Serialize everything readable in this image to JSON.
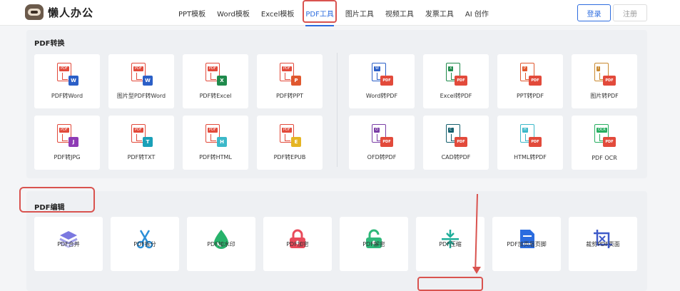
{
  "header": {
    "logo_text": "懒人办公",
    "nav": [
      "PPT模板",
      "Word模板",
      "Excel模板",
      "PDF工具",
      "图片工具",
      "视频工具",
      "发票工具",
      "AI 创作"
    ],
    "active_nav_index": 3,
    "login_label": "登录",
    "register_label": "注册"
  },
  "pdf_convert": {
    "title": "PDF转换",
    "left_row1": [
      {
        "label": "PDF转Word",
        "tag": "W",
        "color": "#2b5fc7"
      },
      {
        "label": "图片型PDF转Word",
        "tag": "W",
        "color": "#2b5fc7"
      },
      {
        "label": "PDF转Excel",
        "tag": "X",
        "color": "#1f8a4c"
      },
      {
        "label": "PDF转PPT",
        "tag": "P",
        "color": "#e0582f"
      }
    ],
    "left_row2": [
      {
        "label": "PDF转JPG",
        "tag": "J",
        "color": "#8e3bb5"
      },
      {
        "label": "PDF转TXT",
        "tag": "T",
        "color": "#1aa0b8"
      },
      {
        "label": "PDF转HTML",
        "tag": "H",
        "color": "#3cb8c9"
      },
      {
        "label": "PDF转EPUB",
        "tag": "E",
        "color": "#e5b523"
      }
    ],
    "right_row1": [
      {
        "label": "Word转PDF",
        "tag": "W",
        "color": "#2b5fc7"
      },
      {
        "label": "Excel转PDF",
        "tag": "X",
        "color": "#1f8a4c"
      },
      {
        "label": "PPT转PDF",
        "tag": "P",
        "color": "#e0582f"
      },
      {
        "label": "图片转PDF",
        "tag": "I",
        "color": "#c9892f"
      }
    ],
    "right_row2": [
      {
        "label": "OFD转PDF",
        "tag": "O",
        "color": "#7b3fa6"
      },
      {
        "label": "CAD转PDF",
        "tag": "C",
        "color": "#16606e"
      },
      {
        "label": "HTML转PDF",
        "tag": "H",
        "color": "#3cb8c9"
      },
      {
        "label": "PDF OCR",
        "tag": "OCR",
        "color": "#27ae60"
      }
    ],
    "pdf_tag": "PDF",
    "pdf_color": "#e24a3b"
  },
  "pdf_edit": {
    "title": "PDF编辑",
    "tools": [
      {
        "label": "PDF合并",
        "icon": "layers-icon",
        "color": "#7b78e0"
      },
      {
        "label": "PDF拆分",
        "icon": "scissors-icon",
        "color": "#2b8fd8"
      },
      {
        "label": "PDF加水印",
        "icon": "droplet-icon",
        "color": "#27b36b"
      },
      {
        "label": "PDF加密",
        "icon": "lock-icon",
        "color": "#e94b5b"
      },
      {
        "label": "PDF解密",
        "icon": "unlock-icon",
        "color": "#2fb87a"
      },
      {
        "label": "PDF压缩",
        "icon": "compress-icon",
        "color": "#1fae9a"
      },
      {
        "label": "PDF加页眉页脚",
        "icon": "header-footer-icon",
        "color": "#2b6cdf"
      },
      {
        "label": "裁剪PDF页面",
        "icon": "crop-icon",
        "color": "#3f5bc9"
      }
    ]
  }
}
